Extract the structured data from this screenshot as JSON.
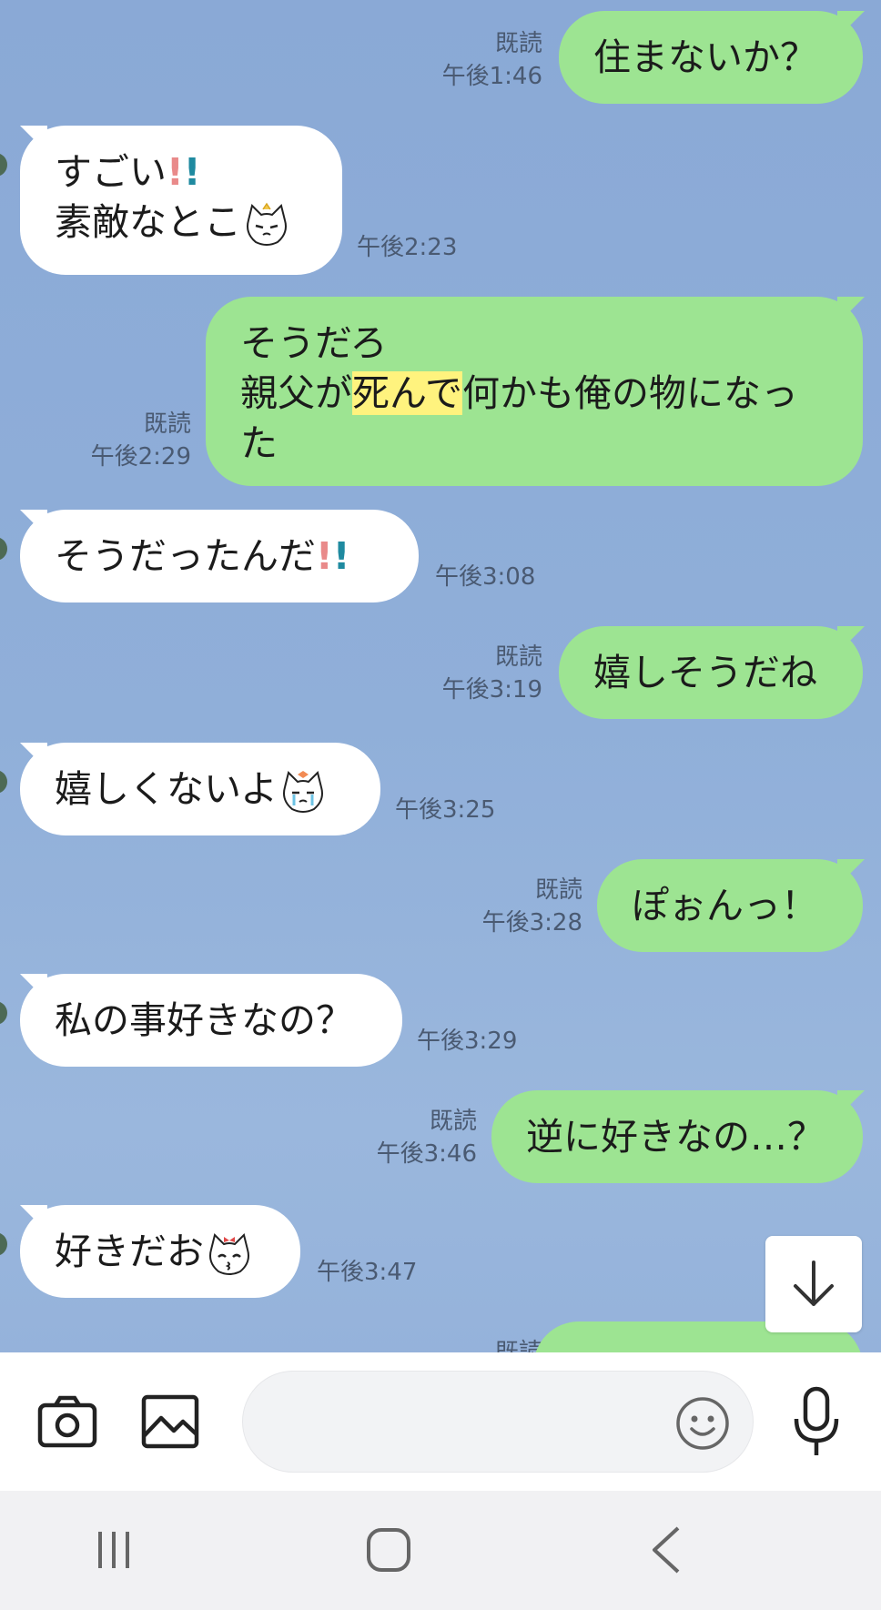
{
  "messages": [
    {
      "dir": "sent",
      "lines": [
        "住まないか？"
      ],
      "read": "既読",
      "time": "午後1:46"
    },
    {
      "dir": "recv",
      "lines": [
        "すごい",
        "素敵なとこ"
      ],
      "time": "午後2:23",
      "emoji": "cat-annoyed",
      "excl": "!!"
    },
    {
      "dir": "sent",
      "lines": [
        "そうだろ",
        "親父が",
        "死んで",
        "何かも俺の物になっ",
        "た"
      ],
      "read": "既読",
      "time": "午後2:29"
    },
    {
      "dir": "recv",
      "lines": [
        "そうだったんだ"
      ],
      "time": "午後3:08",
      "excl": "!!"
    },
    {
      "dir": "sent",
      "lines": [
        "嬉しそうだね"
      ],
      "read": "既読",
      "time": "午後3:19"
    },
    {
      "dir": "recv",
      "lines": [
        "嬉しくないよ"
      ],
      "time": "午後3:25",
      "emoji": "cat-crying"
    },
    {
      "dir": "sent",
      "lines": [
        "ぽぉんっ！"
      ],
      "read": "既読",
      "time": "午後3:28"
    },
    {
      "dir": "recv",
      "lines": [
        "私の事好きなの？"
      ],
      "time": "午後3:29"
    },
    {
      "dir": "sent",
      "lines": [
        "逆に好きなの…？"
      ],
      "read": "既読",
      "time": "午後3:46"
    },
    {
      "dir": "recv",
      "lines": [
        "好きだお"
      ],
      "time": "午後3:47",
      "emoji": "cat-kiss"
    },
    {
      "dir": "sent",
      "lines": [
        ""
      ],
      "read": "既読",
      "time": ""
    }
  ],
  "icons": {
    "scroll_down": "arrow-down-icon",
    "camera": "camera-icon",
    "image": "image-icon",
    "emoji": "smiley-icon",
    "mic": "microphone-icon",
    "nav_recent": "recent-apps-icon",
    "nav_home": "home-icon",
    "nav_back": "back-icon"
  },
  "colors": {
    "sent_bubble": "#9de492",
    "recv_bubble": "#ffffff",
    "background": "#8fadd8",
    "highlight": "#fff37e",
    "meta_text": "#4a5a72"
  }
}
